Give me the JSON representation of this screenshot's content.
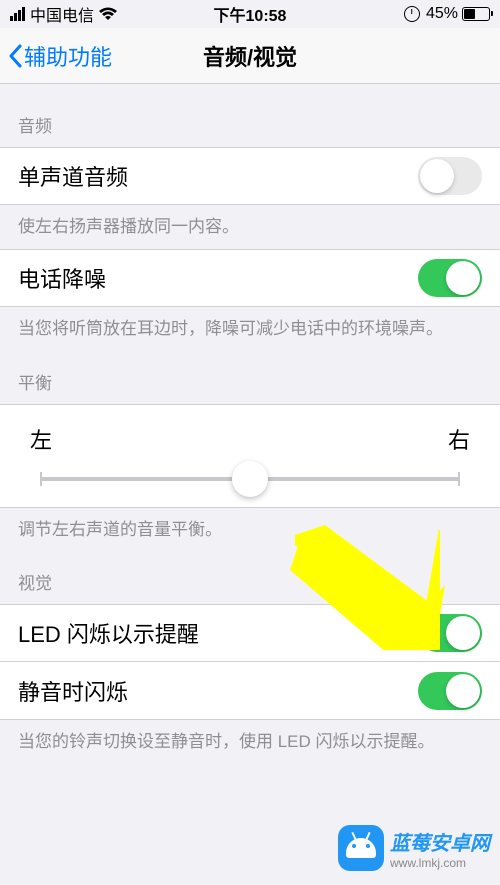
{
  "statusBar": {
    "carrier": "中国电信",
    "time": "下午10:58",
    "battery": "45%"
  },
  "nav": {
    "back": "辅助功能",
    "title": "音频/视觉"
  },
  "sections": {
    "audio": {
      "header": "音频",
      "monoAudio": {
        "label": "单声道音频",
        "footer": "使左右扬声器播放同一内容。"
      },
      "noiseCancellation": {
        "label": "电话降噪",
        "footer": "当您将听筒放在耳边时，降噪可减少电话中的环境噪声。"
      }
    },
    "balance": {
      "header": "平衡",
      "left": "左",
      "right": "右",
      "footer": "调节左右声道的音量平衡。"
    },
    "visual": {
      "header": "视觉",
      "ledFlash": {
        "label": "LED 闪烁以示提醒"
      },
      "flashOnSilent": {
        "label": "静音时闪烁",
        "footer": "当您的铃声切换设至静音时，使用 LED 闪烁以示提醒。"
      }
    }
  },
  "watermark": {
    "title": "蓝莓安卓网",
    "url": "www.lmkj.com"
  }
}
